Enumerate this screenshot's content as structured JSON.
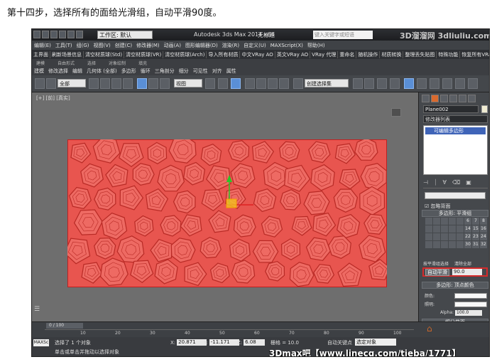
{
  "caption": "第十四步，选择所有的面给光滑组，自动平滑90度。",
  "titlebar": {
    "workspace": "工作区: 默认",
    "app_name": "Autodesk 3ds Max 2014 x64",
    "doc_name": "无标题",
    "search_placeholder": "键入关键字或短语",
    "logo_text": "3D溜溜网 3dliuliu.com"
  },
  "menubar": [
    "编辑(E)",
    "工具(T)",
    "组(G)",
    "视图(V)",
    "创建(C)",
    "修改器(M)",
    "动画(A)",
    "图形编辑器(D)",
    "渲染(R)",
    "自定义(U)",
    "MAXScript(X)",
    "帮助(H)"
  ],
  "ribbon": [
    "主界面",
    "刷新场景信息",
    "清空材质球(Std)",
    "清空材质球(VR)",
    "清空材质球(Arch)",
    "导入所有材质",
    "中文VRay AO",
    "英文VRay AO",
    "VRay 代理",
    "重命名",
    "随机操作",
    "材质转换",
    "整理丢失贴图",
    "特殊功能",
    "恢复所有VRay对"
  ],
  "tabs_row": [
    "建模",
    "自由形式",
    "选择",
    "对象绘制",
    "填充"
  ],
  "subtabs": [
    "建模",
    "修改选择",
    "编辑",
    "几何体 (全部)",
    "多边形",
    "循环",
    "三角剖分",
    "细分",
    "可见性",
    "对齐",
    "属性"
  ],
  "toolbar": {
    "filter_value": "全部",
    "view_value": "视图",
    "named_set_value": "创建选择集"
  },
  "viewport": {
    "label": "[+] [前] [真实]",
    "panel_color": "#e8554f"
  },
  "command_panel": {
    "object_name": "Plane002",
    "modifier_list": "修改器列表",
    "stack_item": "可编辑多边形",
    "ignore_backfacing": "忽略背面",
    "rollout_smoothing": "多边形: 平滑组",
    "smoothing_numbers": [
      [
        "6",
        "7",
        "8"
      ],
      [
        "14",
        "15",
        "16"
      ],
      [
        "22",
        "23",
        "24"
      ],
      [
        "30",
        "31",
        "32"
      ]
    ],
    "select_by_sg": "按平滑组选择",
    "clear_all": "清除全部",
    "auto_smooth_label": "自动平滑",
    "auto_smooth_value": "90.0",
    "rollout_vertex_colors": "多边形: 顶点颜色",
    "color_label": "颜色:",
    "illum_label": "照明:",
    "alpha_label": "Alpha:",
    "alpha_value": "100.0",
    "rollout_subdiv": "细分曲面"
  },
  "timeline": {
    "slider_text": "0 / 100",
    "ticks": [
      "10",
      "20",
      "30",
      "40",
      "50",
      "60",
      "70",
      "80",
      "90",
      "100"
    ]
  },
  "statusbar": {
    "maxscript": "MAXSc",
    "selected_text": "选择了 1 个对象",
    "prompt_text": "单击或单击并拖动以选择对象",
    "x_label": "X:",
    "x_value": "20.871",
    "y_label": "Y:",
    "y_value": "-11.171",
    "z_label": "Z:",
    "z_value": "6.08",
    "grid_text": "栅格 = 10.0",
    "auto_key": "自动关键点",
    "selection_set": "选定对象"
  },
  "watermark": "3Dmax吧【www.linecg.com/tieba/1771】"
}
